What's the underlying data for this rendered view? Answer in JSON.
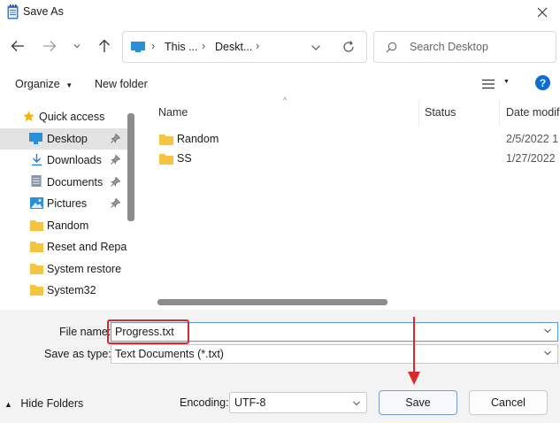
{
  "window": {
    "title": "Save As"
  },
  "nav": {
    "breadcrumb": [
      "This ...",
      "Deskt..."
    ],
    "search_placeholder": "Search Desktop"
  },
  "toolbar": {
    "organize_label": "Organize",
    "new_folder_label": "New folder"
  },
  "sidebar": {
    "items": [
      {
        "label": "Quick access",
        "icon": "star-icon"
      },
      {
        "label": "Desktop",
        "icon": "desktop-icon",
        "pinned": true,
        "selected": true
      },
      {
        "label": "Downloads",
        "icon": "download-icon",
        "pinned": true
      },
      {
        "label": "Documents",
        "icon": "documents-icon",
        "pinned": true
      },
      {
        "label": "Pictures",
        "icon": "pictures-icon",
        "pinned": true
      },
      {
        "label": "Random",
        "icon": "folder-icon"
      },
      {
        "label": "Reset and Repair",
        "icon": "folder-icon"
      },
      {
        "label": "System restore",
        "icon": "folder-icon"
      },
      {
        "label": "System32",
        "icon": "folder-icon"
      }
    ]
  },
  "files": {
    "columns": [
      "Name",
      "Status",
      "Date modif"
    ],
    "rows": [
      {
        "name": "Random",
        "date": "2/5/2022 1"
      },
      {
        "name": "SS",
        "date": "1/27/2022"
      }
    ]
  },
  "form": {
    "file_name_label": "File name:",
    "file_name_value": "Progress.txt",
    "save_type_label": "Save as type:",
    "save_type_value": "Text Documents (*.txt)",
    "encoding_label": "Encoding:",
    "encoding_value": "UTF-8"
  },
  "footer": {
    "hide_folders_label": "Hide Folders",
    "save_label": "Save",
    "cancel_label": "Cancel"
  },
  "colors": {
    "accent": "#0a6cd6",
    "highlight": "#d9292b",
    "folder": "#f5c542"
  }
}
